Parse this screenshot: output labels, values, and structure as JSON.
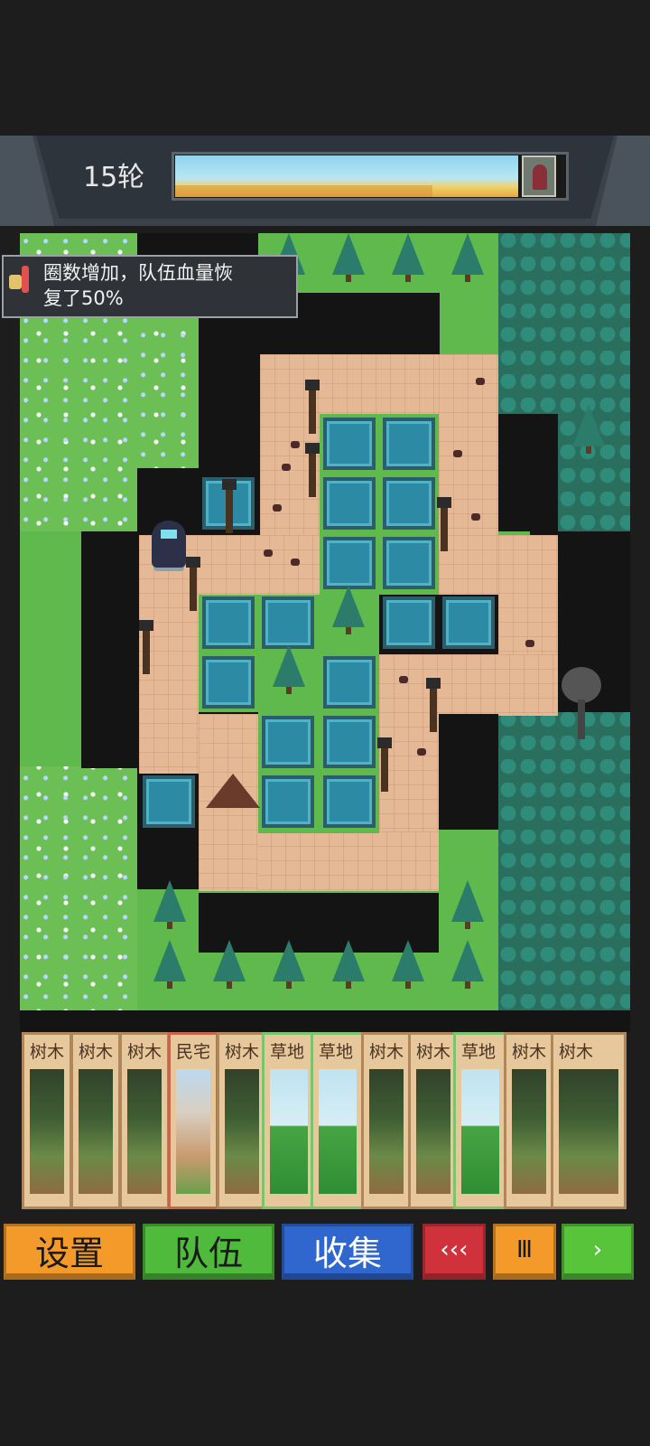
{
  "hud": {
    "round_label": "15轮",
    "day_progress_percent": 75,
    "boss_icon": "witch-portrait-icon"
  },
  "toast": {
    "icon": "potion-icon",
    "message_line1": "圈数增加，队伍血量恢",
    "message_line2": "复了50%"
  },
  "cards": [
    {
      "title": "树木",
      "art": "tree"
    },
    {
      "title": "树木",
      "art": "tree"
    },
    {
      "title": "树木",
      "art": "tree"
    },
    {
      "title": "民宅",
      "art": "house"
    },
    {
      "title": "树木",
      "art": "tree"
    },
    {
      "title": "草地",
      "art": "grass"
    },
    {
      "title": "草地",
      "art": "grass"
    },
    {
      "title": "树木",
      "art": "tree"
    },
    {
      "title": "树木",
      "art": "tree"
    },
    {
      "title": "草地",
      "art": "grass"
    },
    {
      "title": "树木",
      "art": "tree"
    },
    {
      "title": "树木",
      "art": "tree"
    }
  ],
  "buttons": {
    "settings": "设置",
    "team": "队伍",
    "collect": "收集",
    "rewind": "‹‹‹",
    "pause": "Ⅲ",
    "play": "›"
  },
  "colors": {
    "settings": "#f39a2a",
    "team": "#4fba3c",
    "collect": "#2f67cf",
    "rewind": "#d0323b",
    "play": "#57c43a"
  }
}
